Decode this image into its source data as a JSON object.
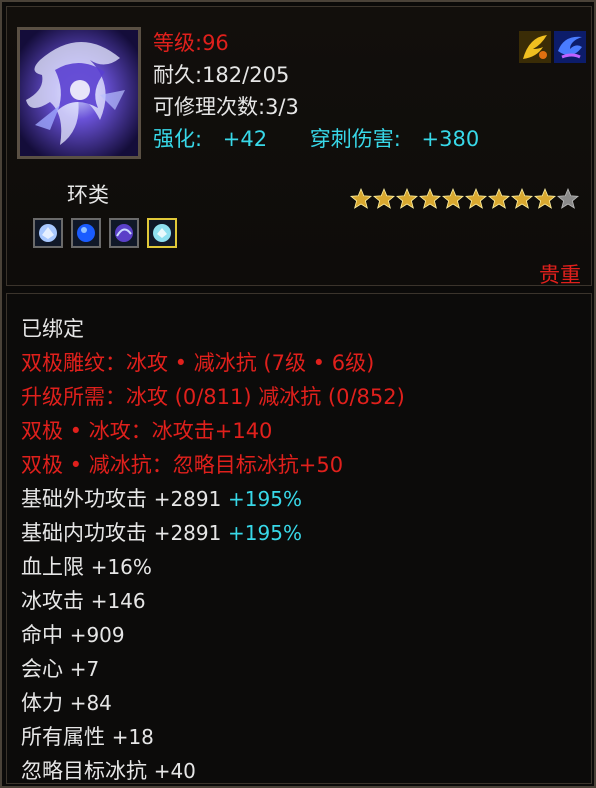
{
  "item": {
    "level_label": "等级:96",
    "durability": "耐久:182/205",
    "repair_count": "可修理次数:3/3",
    "enhance": "强化:",
    "enhance_value": "+42",
    "pierce": "穿刺伤害:",
    "pierce_value": "+380",
    "type": "环类",
    "rarity": "贵重",
    "stars": {
      "filled": 9,
      "total": 10
    },
    "gems": [
      "ice-gem",
      "blue-gem",
      "purple-gem",
      "ice-gem-selected"
    ],
    "top_icons": [
      "gold-feather-icon",
      "blue-swirl-icon"
    ]
  },
  "details": {
    "bound": "已绑定",
    "red_lines": [
      "双极雕纹：冰攻 • 减冰抗 (7级 • 6级)",
      "升级所需：冰攻 (0/811)  减冰抗 (0/852)",
      "双极 • 冰攻：冰攻击+140",
      "双极 • 减冰抗：忽略目标冰抗+50"
    ],
    "stats": [
      {
        "label": "基础外功攻击",
        "value": "+2891",
        "bonus": "+195%"
      },
      {
        "label": "基础内功攻击",
        "value": "+2891",
        "bonus": "+195%"
      },
      {
        "label": "血上限",
        "value": "+16%",
        "bonus": ""
      },
      {
        "label": "冰攻击",
        "value": "+146",
        "bonus": ""
      },
      {
        "label": "命中",
        "value": "+909",
        "bonus": ""
      },
      {
        "label": "会心",
        "value": "+7",
        "bonus": ""
      },
      {
        "label": "体力",
        "value": "+84",
        "bonus": ""
      },
      {
        "label": "所有属性",
        "value": "+18",
        "bonus": ""
      },
      {
        "label": "忽略目标冰抗",
        "value": "+40",
        "bonus": ""
      }
    ]
  },
  "colors": {
    "red": "#e0201c",
    "white": "#e6e6e6",
    "cyan": "#38d8e8",
    "gold": "#d8a830"
  }
}
